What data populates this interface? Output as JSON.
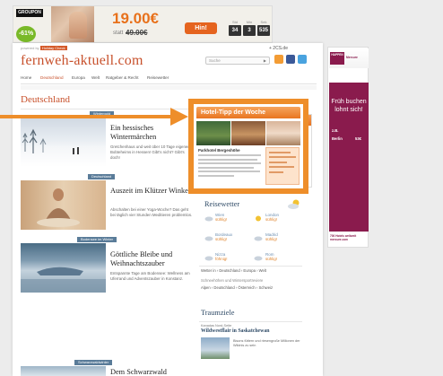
{
  "banner_ad": {
    "brand": "GROUPON",
    "discount": "-61%",
    "price": "19.00€",
    "old_label": "statt",
    "old_price": "49.00€",
    "cta": "Hin!",
    "countdown": [
      {
        "label": "Std",
        "value": "34"
      },
      {
        "label": "Min",
        "value": "3"
      },
      {
        "label": "Sek",
        "value": "535"
      }
    ]
  },
  "site": {
    "powered_by": "powered by",
    "powered_brand": "Holiday Check",
    "logo": "fernweh-aktuell.com",
    "fb_count": "+ 2CS.de",
    "search_placeholder": "Suche",
    "nav": [
      "Home",
      "Deutschland",
      "Europa",
      "Welt",
      "Ratgeber & Recht",
      "Reisewetter"
    ],
    "active_nav": "Deutschland",
    "section_title": "Deutschland"
  },
  "articles": [
    {
      "tag": "Wintergold",
      "title": "Ein hessisches Wintermärchen",
      "text": "Gretchenhaus und weit über 10 Tage eigener Bobteheims in Hessen! Gibt's nicht? Gibt's doch!"
    },
    {
      "tag": "Deutschland",
      "title": "Auszeit im Klützer Winkel",
      "text": "Abschalten bei einer Yoga-Woche? Das geht bei täglich vier Stunden Meditieren problemlos."
    },
    {
      "tag": "Bodensee im Winter",
      "title": "Göttliche Bleibe und Weihnachtszauber",
      "text": "Entspannte Tage am Bodensee: Wellness am Uferrand und Adventszauber in Konstanz."
    },
    {
      "tag": "Schwarzwaldwinter",
      "title": "Dem Schwarzwald",
      "text": ""
    }
  ],
  "hotel_tip": {
    "header": "Hotel-Tipp der Woche",
    "name": "Parkhotel Bergeshöhe"
  },
  "weather": {
    "title": "Reisewetter",
    "cities": [
      {
        "city": "Wien",
        "temp": "sühlig!"
      },
      {
        "city": "London",
        "temp": "sühlig!"
      },
      {
        "city": "Bordeaux",
        "temp": "sühlig!"
      },
      {
        "city": "Madrid",
        "temp": "sühlig!"
      },
      {
        "city": "Nizza",
        "temp": "föhnig!"
      },
      {
        "city": "Rom",
        "temp": "sühlig!"
      }
    ],
    "row1": "Wetter in  ›  Deutschland  ›  Europa  ›  Welt",
    "row2": "Schneehöhen und Wintersportreviere",
    "row3": "Alpen  ›  Deutschland  ›  Österreich  ›  Schweiz"
  },
  "traumziele": {
    "title": "Traumziele",
    "kicker": "Kanadas Nord-Seite",
    "headline": "Wildwestflair in Saskatchewan",
    "text": "Bisons füttern und riesengroße Millionen der Wildnis zu sein"
  },
  "sky_ad": {
    "brand": "Mercure",
    "logo_text": "HAPPEN",
    "headline": "Früh buchen lohnt sich!",
    "small1": "z.B.",
    "city": "Berlin",
    "price": "53€",
    "footer": "700 Hotels weltweit mercure.com"
  },
  "colors": {
    "accent_orange": "#ee8e2a",
    "logo_red": "#c8512c",
    "sky_ad_purple": "#8a1b4d",
    "widget_blue": "#2e4a66"
  }
}
